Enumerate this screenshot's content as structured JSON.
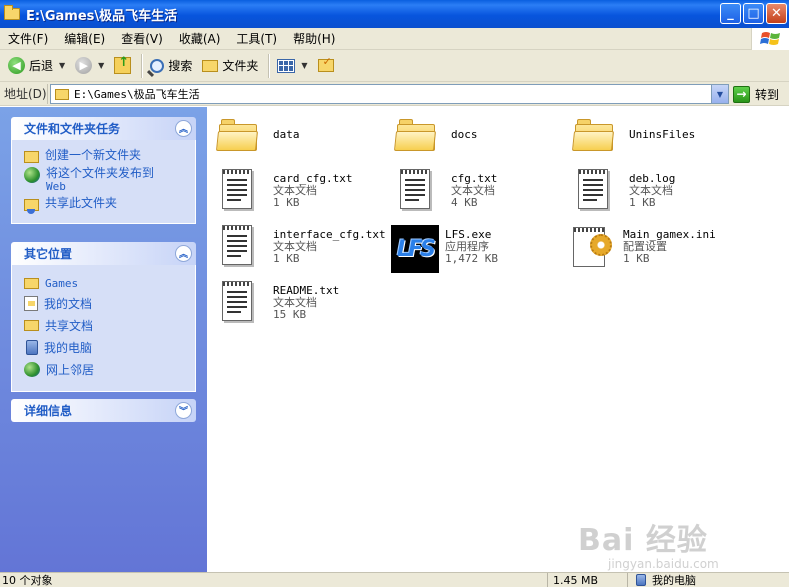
{
  "window": {
    "title": "E:\\Games\\极品飞车生活",
    "buttons": {
      "minimize": "_",
      "maximize": "□",
      "close": "✕"
    }
  },
  "menu": [
    "文件(F)",
    "编辑(E)",
    "查看(V)",
    "收藏(A)",
    "工具(T)",
    "帮助(H)"
  ],
  "toolbar": {
    "back_label": "后退",
    "back_glyph": "◀",
    "forward_glyph": "▶",
    "dropdown_glyph": "▼",
    "search_label": "搜索",
    "folders_label": "文件夹"
  },
  "address": {
    "label": "地址(D)",
    "path": "E:\\Games\\极品飞车生活",
    "dropdown_glyph": "▼",
    "go_label": "转到",
    "go_glyph": "→"
  },
  "left_pane": {
    "tasks": {
      "title": "文件和文件夹任务",
      "toggle_glyph": "︽",
      "items": [
        {
          "label": "创建一个新文件夹",
          "icon": "new-folder-icon"
        },
        {
          "label": "将这个文件夹发布到",
          "label2": "Web",
          "icon": "publish-web-icon"
        },
        {
          "label": "共享此文件夹",
          "icon": "share-folder-icon"
        }
      ]
    },
    "places": {
      "title": "其它位置",
      "toggle_glyph": "︽",
      "items": [
        {
          "label": "Games",
          "icon": "folder-icon"
        },
        {
          "label": "我的文档",
          "icon": "my-documents-icon"
        },
        {
          "label": "共享文档",
          "icon": "shared-documents-icon"
        },
        {
          "label": "我的电脑",
          "icon": "my-computer-icon"
        },
        {
          "label": "网上邻居",
          "icon": "network-places-icon"
        }
      ]
    },
    "details": {
      "title": "详细信息",
      "toggle_glyph": "︾"
    }
  },
  "files": [
    {
      "name": "data",
      "type": "",
      "size": "",
      "icon": "folder-icon"
    },
    {
      "name": "docs",
      "type": "",
      "size": "",
      "icon": "folder-icon"
    },
    {
      "name": "UninsFiles",
      "type": "",
      "size": "",
      "icon": "folder-icon"
    },
    {
      "name": "card_cfg.txt",
      "type": "文本文档",
      "size": "1 KB",
      "icon": "text-document-icon"
    },
    {
      "name": "cfg.txt",
      "type": "文本文档",
      "size": "4 KB",
      "icon": "text-document-icon"
    },
    {
      "name": "deb.log",
      "type": "文本文档",
      "size": "1 KB",
      "icon": "text-document-icon"
    },
    {
      "name": "interface_cfg.txt",
      "type": "文本文档",
      "size": "1 KB",
      "icon": "text-document-icon"
    },
    {
      "name": "LFS.exe",
      "type": "应用程序",
      "size": "1,472 KB",
      "icon": "lfs-app-icon",
      "icon_text": "LFS"
    },
    {
      "name": "Main_gamex.ini",
      "type": "配置设置",
      "size": "1 KB",
      "icon": "config-settings-icon"
    },
    {
      "name": "README.txt",
      "type": "文本文档",
      "size": "15 KB",
      "icon": "text-document-icon"
    }
  ],
  "status": {
    "count": "10 个对象",
    "size": "1.45 MB",
    "location": "我的电脑"
  },
  "watermark": {
    "main": "Bai 经验",
    "sub": "jingyan.baidu.com"
  },
  "colors": {
    "title_bar": "#0a5fdf",
    "task_pane": "#6f8ce0",
    "link": "#215dc6"
  }
}
